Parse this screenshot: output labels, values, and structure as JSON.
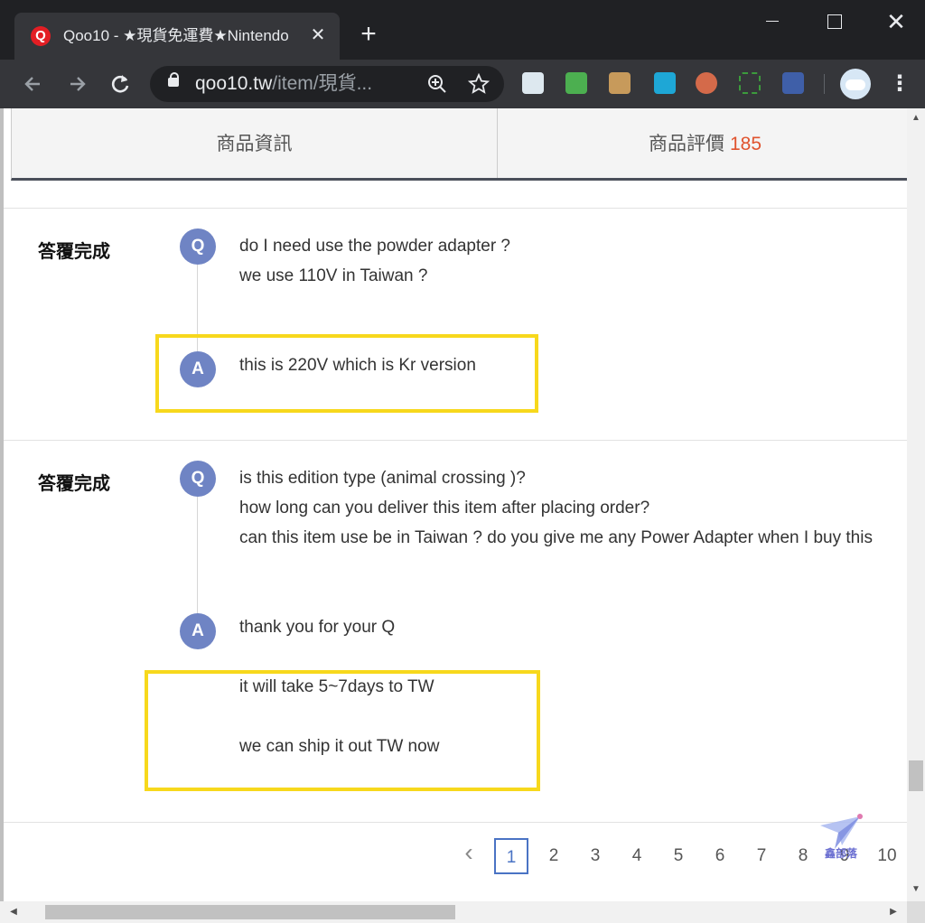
{
  "browser": {
    "tab_title": "Qoo10 - ★現貨免運費★Nintendo",
    "favicon_letter": "Q",
    "tab_close": "✕",
    "new_tab": "+",
    "url_host": "qoo10.tw",
    "url_path": "/item/現貨...",
    "close_window": "✕"
  },
  "page_tabs": {
    "info_label": "商品資訊",
    "reviews_label": "商品評價",
    "reviews_count": "185"
  },
  "questions": [
    {
      "status": "答覆完成",
      "q_badge": "Q",
      "q_lines": [
        "do I need use the powder adapter ?",
        "we use 110V in Taiwan ?"
      ],
      "a_badge": "A",
      "a_lines": [
        "this is 220V which is Kr version"
      ]
    },
    {
      "status": "答覆完成",
      "q_badge": "Q",
      "q_lines": [
        "is this edition type (animal crossing )?",
        "how long can you deliver this item after placing order?",
        "can this item use be in Taiwan ? do you give me any Power Adapter when I buy this"
      ],
      "a_badge": "A",
      "a_lines": [
        "thank you for your Q",
        "it will take 5~7days to TW",
        "we can ship it out TW now"
      ]
    }
  ],
  "pagination": {
    "prev": "‹",
    "pages": [
      "1",
      "2",
      "3",
      "4",
      "5",
      "6",
      "7",
      "8",
      "9",
      "10"
    ],
    "active": "1"
  },
  "watermark_text": "鑫部落",
  "colors": {
    "badge": "#6f84c4",
    "highlight": "#f7d81c",
    "review_count": "#e0532e",
    "active_page": "#4a73c4"
  }
}
